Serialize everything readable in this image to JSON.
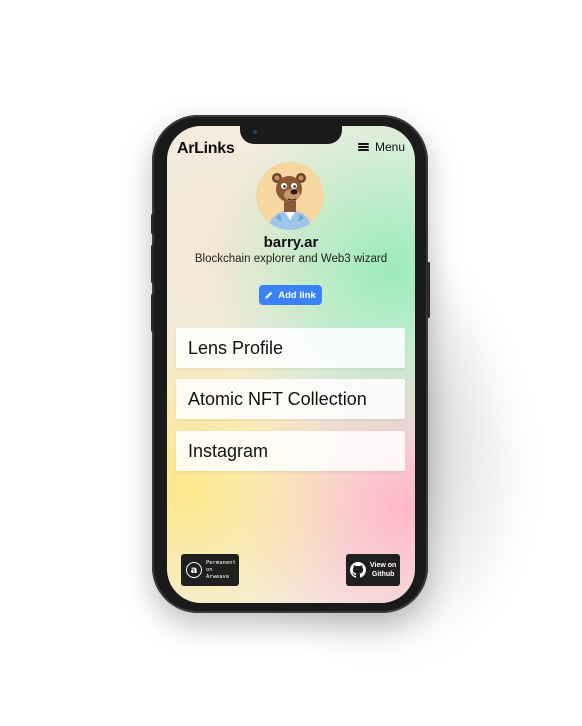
{
  "header": {
    "brand": "ArLinks",
    "menu_label": "Menu"
  },
  "profile": {
    "username": "barry.ar",
    "bio": "Blockchain explorer and Web3 wizard",
    "avatar_icon": "bear-avatar"
  },
  "actions": {
    "add_link_label": "Add link"
  },
  "links": [
    {
      "label": "Lens Profile"
    },
    {
      "label": "Atomic NFT Collection"
    },
    {
      "label": "Instagram"
    }
  ],
  "footer": {
    "arweave_badge_line1": "Permanent",
    "arweave_badge_line2": "on Arweave",
    "github_badge_line1": "View on",
    "github_badge_line2": "Github"
  },
  "colors": {
    "accent": "#3b82f6",
    "badge_bg": "#1f1f1f",
    "phone_frame": "#1a1a1a"
  }
}
